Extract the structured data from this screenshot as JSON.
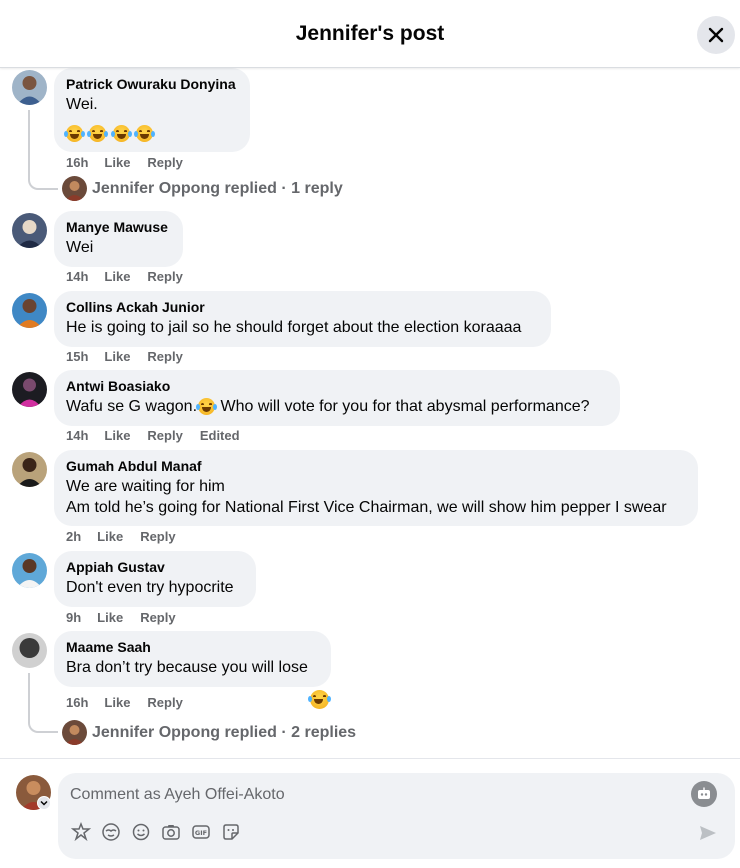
{
  "header": {
    "title": "Jennifer's post"
  },
  "comments": [
    {
      "author": "Patrick Owuraku Donyina",
      "lines": [
        "Wei."
      ],
      "emoji_count": 4,
      "time": "16h",
      "like": "Like",
      "reply": "Reply",
      "replies_summary": {
        "text": "Jennifer Oppong replied · 1 reply"
      }
    },
    {
      "author": "Manye Mawuse",
      "lines": [
        "Wei"
      ],
      "time": "14h",
      "like": "Like",
      "reply": "Reply"
    },
    {
      "author": "Collins Ackah Junior",
      "lines": [
        "He is going to jail so he should forget about the election koraaaa"
      ],
      "time": "15h",
      "like": "Like",
      "reply": "Reply"
    },
    {
      "author": "Antwi Boasiako",
      "lines_before_emoji": "Wafu se G wagon.",
      "lines_after_emoji": " Who will vote for you for that abysmal performance?",
      "time": "14h",
      "like": "Like",
      "reply": "Reply",
      "edited": "Edited"
    },
    {
      "author": "Gumah Abdul Manaf",
      "lines": [
        "We are waiting for him",
        "Am told he’s going for National First Vice Chairman, we will show him pepper I swear"
      ],
      "time": "2h",
      "like": "Like",
      "reply": "Reply"
    },
    {
      "author": "Appiah Gustav",
      "lines": [
        "Don't even try hypocrite"
      ],
      "time": "9h",
      "like": "Like",
      "reply": "Reply"
    },
    {
      "author": "Maame Saah",
      "lines": [
        "Bra don’t try because you will lose"
      ],
      "time": "16h",
      "like": "Like",
      "reply": "Reply",
      "replies_summary": {
        "text": "Jennifer Oppong replied · 2 replies"
      }
    }
  ],
  "composer": {
    "placeholder": "Comment as Ayeh Offei-Akoto"
  },
  "colors": {
    "bubble": "#f0f2f5",
    "meta_text": "#65676b",
    "emoji": "#f7b928"
  }
}
